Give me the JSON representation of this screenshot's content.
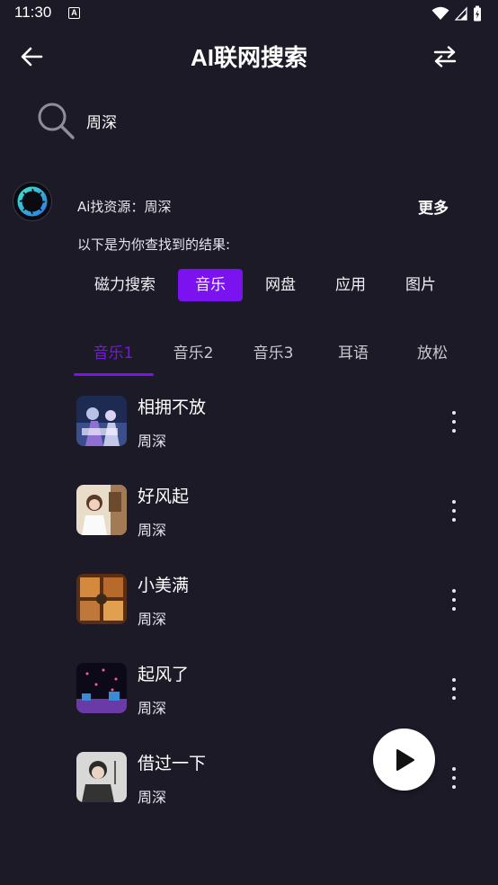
{
  "status_bar": {
    "time": "11:30",
    "notif_letter": "A"
  },
  "header": {
    "title": "AI联网搜索"
  },
  "search": {
    "query": "周深"
  },
  "ai": {
    "source_label": "Ai找资源：",
    "source_value": "周深",
    "more_label": "更多",
    "intro": "以下是为你查找到的结果:"
  },
  "categories": [
    {
      "label": "磁力搜索",
      "active": false
    },
    {
      "label": "音乐",
      "active": true
    },
    {
      "label": "网盘",
      "active": false
    },
    {
      "label": "应用",
      "active": false
    },
    {
      "label": "图片",
      "active": false
    }
  ],
  "tabs": [
    {
      "label": "音乐1",
      "active": true
    },
    {
      "label": "音乐2",
      "active": false
    },
    {
      "label": "音乐3",
      "active": false
    },
    {
      "label": "耳语",
      "active": false
    },
    {
      "label": "放松",
      "active": false
    }
  ],
  "songs": [
    {
      "title": "相拥不放",
      "artist": "周深"
    },
    {
      "title": "好风起",
      "artist": "周深"
    },
    {
      "title": "小美满",
      "artist": "周深"
    },
    {
      "title": "起风了",
      "artist": "周深"
    },
    {
      "title": "借过一下",
      "artist": "周深"
    }
  ],
  "colors": {
    "background": "#1c1a26",
    "accent": "#7b12f0",
    "text": "#ffffff"
  },
  "icons": {
    "back": "arrow-left-icon",
    "swap": "swap-arrows-icon",
    "search": "magnifier-icon",
    "ai": "ai-aperture-icon",
    "more": "vertical-dots-icon",
    "play": "play-icon"
  }
}
